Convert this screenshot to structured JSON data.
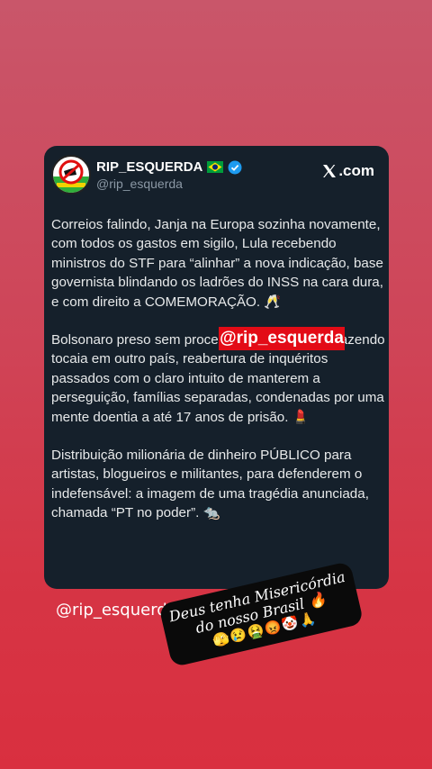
{
  "tweet": {
    "display_name": "RIP_ESQUERDA",
    "handle": "@rip_esquerda",
    "source_label": ".com",
    "paragraphs": [
      "Correios falindo, Janja na Europa sozinha novamente, com todos os gastos em sigilo, Lula recebendo ministros do STF para “alinhar” a nova indicação, base governista blindando os ladrões do INSS na cara dura, e com direito a COMEMORAÇÃO. 🥂",
      "Bolsonaro preso sem processo, polícia federal fazendo tocaia em outro país, reabertura de inquéritos passados com o claro intuito de manterem a perseguição, famílias separadas, condenadas por uma mente doentia a até 17 anos de prisão. 💄",
      "Distribuição milionária de dinheiro PÚBLICO para artistas, blogueiros e militantes, para defenderem o indefensável: a imagem de uma tragédia anunciada, chamada “PT no poder”. 🐀"
    ]
  },
  "stickers": {
    "red_tag": "@rip_esquerda",
    "handle_caption": "@rip_esquerda",
    "black_caption": "Deus tenha Misericórdia do nosso Brasil 🔥",
    "emoji_line": "🫣😢🤮😡🤡🙏"
  },
  "colors": {
    "background_top": "#c9566a",
    "background_bottom": "#d92f3f",
    "card": "#15202b",
    "red_tag": "#e30b16"
  },
  "icons": [
    "brazil-flag-icon",
    "verified-badge-icon",
    "x-logo-icon",
    "avatar-logo"
  ]
}
